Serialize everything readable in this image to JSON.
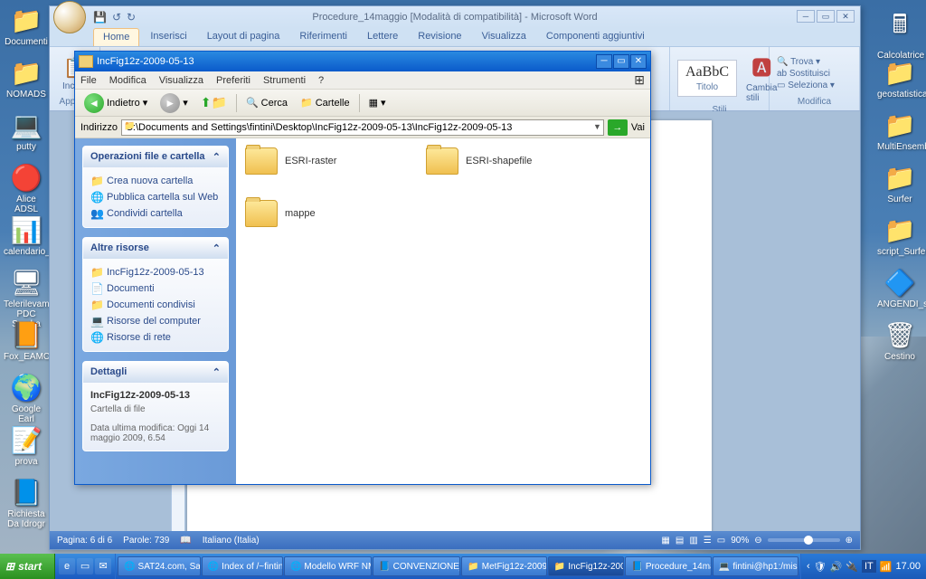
{
  "desktop_icons_left": [
    {
      "label": "Documenti",
      "glyph": "📁"
    },
    {
      "label": "NOMADS",
      "glyph": "📁"
    },
    {
      "label": "putty",
      "glyph": "💻"
    },
    {
      "label": "Alice ADSL",
      "glyph": "🔴"
    },
    {
      "label": "calendario_",
      "glyph": "📊"
    },
    {
      "label": "Telerilevam PDC Samba",
      "glyph": "🖥"
    },
    {
      "label": "Fox_EAMC",
      "glyph": "📙"
    },
    {
      "label": "Google Earl",
      "glyph": "🌍"
    },
    {
      "label": "prova",
      "glyph": "📝"
    },
    {
      "label": "Richiesta Da Idrogr",
      "glyph": "📘"
    }
  ],
  "desktop_icons_right": [
    {
      "label": "Calcolatrice",
      "glyph": "🖩"
    },
    {
      "label": "geostatistica",
      "glyph": "📁"
    },
    {
      "label": "MultiEnsemble",
      "glyph": "📁"
    },
    {
      "label": "Surfer",
      "glyph": "📁"
    },
    {
      "label": "script_Surfer",
      "glyph": "📁"
    },
    {
      "label": "ANGENDI_s",
      "glyph": "🔷"
    },
    {
      "label": "Cestino",
      "glyph": "🗑"
    }
  ],
  "word": {
    "title": "Procedure_14maggio [Modalità di compatibilità] - Microsoft Word",
    "tabs": [
      "Home",
      "Inserisci",
      "Layout di pagina",
      "Riferimenti",
      "Lettere",
      "Revisione",
      "Visualizza",
      "Componenti aggiuntivi"
    ],
    "ribbon": {
      "group1_label": "Appunti",
      "incolla": "Incolla",
      "stili_preview": "AaBbC",
      "stili_label": "Titolo",
      "cambia": "Cambia stili",
      "stili_group": "Stili",
      "trova": "Trova",
      "sostituisci": "Sostituisci",
      "seleziona": "Seleziona",
      "modifica_group": "Modifica"
    },
    "status": {
      "page": "Pagina: 6 di 6",
      "words": "Parole: 739",
      "lang": "Italiano (Italia)",
      "zoom": "90%"
    }
  },
  "explorer": {
    "title": "IncFig12z-2009-05-13",
    "menus": [
      "File",
      "Modifica",
      "Visualizza",
      "Preferiti",
      "Strumenti",
      "?"
    ],
    "toolbar": {
      "back": "Indietro",
      "search": "Cerca",
      "folders": "Cartelle"
    },
    "address_label": "Indirizzo",
    "address_path": "C:\\Documents and Settings\\fintini\\Desktop\\IncFig12z-2009-05-13\\IncFig12z-2009-05-13",
    "go": "Vai",
    "task_file": {
      "hdr": "Operazioni file e cartella",
      "items": [
        "Crea nuova cartella",
        "Pubblica cartella sul Web",
        "Condividi cartella"
      ]
    },
    "task_other": {
      "hdr": "Altre risorse",
      "items": [
        "IncFig12z-2009-05-13",
        "Documenti",
        "Documenti condivisi",
        "Risorse del computer",
        "Risorse di rete"
      ]
    },
    "task_detail": {
      "hdr": "Dettagli",
      "name": "IncFig12z-2009-05-13",
      "type": "Cartella di file",
      "mod": "Data ultima modifica: Oggi 14 maggio 2009, 6.54"
    },
    "folders": [
      "ESRI-raster",
      "ESRI-shapefile",
      "mappe"
    ]
  },
  "taskbar": {
    "start": "start",
    "items": [
      "SAT24.com, Sat...",
      "Index of /~fintini...",
      "Modello WRF NM...",
      "CONVENZIONE_...",
      "MetFig12z-2009-...",
      "IncFig12z-200...",
      "Procedure_14ma...",
      "fintini@hp1:/misc..."
    ],
    "active_index": 5,
    "time": "17.00"
  }
}
